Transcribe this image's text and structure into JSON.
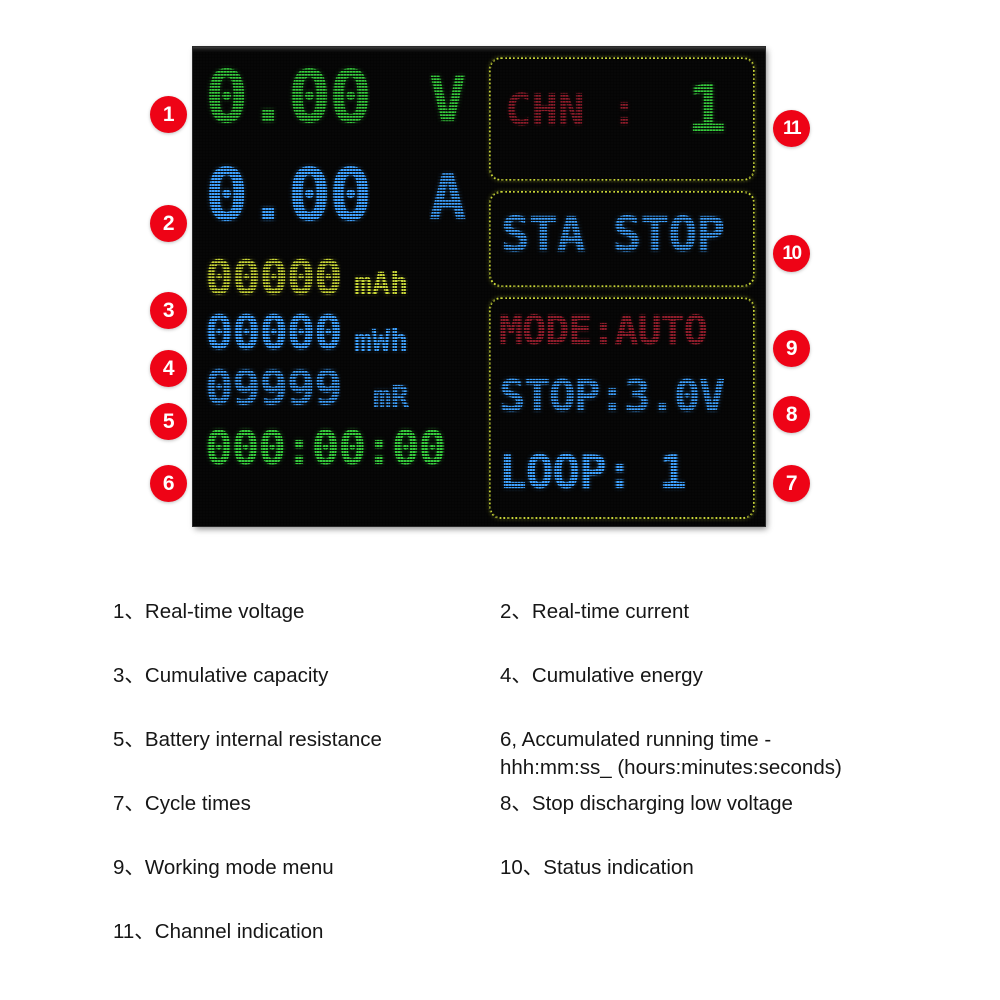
{
  "device": {
    "type": "battery-capacity-tester-lcd",
    "colors": {
      "green": "#37cc3d",
      "blue": "#3fa2ff",
      "yellow": "#c9d638",
      "dark_red": "#8f1d2b",
      "badge_red": "#ee0316",
      "screen_background": "#070707"
    }
  },
  "display": {
    "left": {
      "voltage": {
        "value": "0.00",
        "unit": "V",
        "color": "green"
      },
      "current": {
        "value": "0.00",
        "unit": "A",
        "color": "blue"
      },
      "capacity": {
        "value": "00000",
        "unit": "mAh",
        "color": "yellow"
      },
      "energy": {
        "value": "00000",
        "unit": "mWh",
        "color": "blue"
      },
      "resistance": {
        "value": "09999",
        "unit": "mR",
        "color": "blue"
      },
      "runtime": {
        "value": "000:00:00",
        "color": "green"
      }
    },
    "right": {
      "channel": {
        "label": "CHN :",
        "value": "1",
        "label_color": "dark_red",
        "value_color": "green"
      },
      "status": {
        "text": "STA STOP",
        "color": "blue"
      },
      "mode": {
        "text": "MODE:AUTO",
        "color": "dark_red"
      },
      "stop_voltage": {
        "text": "STOP:3.0V",
        "color": "blue"
      },
      "loop": {
        "text": "LOOP: 1",
        "color": "blue"
      }
    }
  },
  "callouts": {
    "left": [
      "1",
      "2",
      "3",
      "4",
      "5",
      "6"
    ],
    "right": [
      "11",
      "10",
      "9",
      "8",
      "7"
    ]
  },
  "legend": {
    "items": [
      {
        "n": "1",
        "text": "1、Real-time voltage"
      },
      {
        "n": "2",
        "text": "2、Real-time current"
      },
      {
        "n": "3",
        "text": "3、Cumulative capacity"
      },
      {
        "n": "4",
        "text": "4、Cumulative energy"
      },
      {
        "n": "5",
        "text": "5、Battery internal resistance"
      },
      {
        "n": "6",
        "text": "6, Accumulated running time -\nhhh:mm:ss_ (hours:minutes:seconds)"
      },
      {
        "n": "7",
        "text": "7、Cycle times"
      },
      {
        "n": "8",
        "text": "8、Stop discharging low voltage"
      },
      {
        "n": "9",
        "text": "9、Working mode menu"
      },
      {
        "n": "10",
        "text": "10、Status indication"
      },
      {
        "n": "11",
        "text": "11、Channel indication"
      }
    ]
  }
}
